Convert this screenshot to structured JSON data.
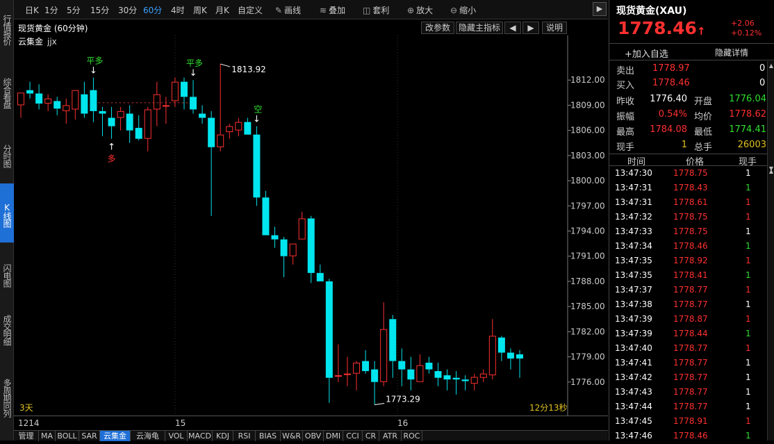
{
  "left_tabs": [
    "行情报价",
    "综合看盘",
    "分时图",
    "K线图",
    "闪电图",
    "成交明细",
    "多周期同列"
  ],
  "active_left_tab": "K线图",
  "toolbar": {
    "periods": [
      "日K",
      "1分",
      "5分",
      "15分",
      "30分",
      "60分",
      "4时",
      "周K",
      "月K",
      "自定义"
    ],
    "selected_period": "60分",
    "tools": [
      {
        "icon": "pencil-icon",
        "glyph": "✎",
        "label": "画线"
      },
      {
        "icon": "stack-icon",
        "glyph": "≋",
        "label": "叠加"
      },
      {
        "icon": "arbitrage-icon",
        "glyph": "◫",
        "label": "套利"
      },
      {
        "icon": "zoom-in-icon",
        "glyph": "⊕",
        "label": "放大"
      },
      {
        "icon": "zoom-out-icon",
        "glyph": "⊖",
        "label": "缩小"
      }
    ],
    "next_glyph": "▶"
  },
  "chart_header": {
    "title": "现货黄金 (60分钟)",
    "buttons": [
      "改参数",
      "隐藏主指标",
      "◀",
      "▶",
      "说明"
    ]
  },
  "indicator_label": "云集金",
  "indicator_param": "jjx",
  "bottom_left_label": "3天",
  "bottom_right_label": "12分13秒",
  "x_labels": [
    "1214",
    "15",
    "16"
  ],
  "indicator_tabs": [
    "管理",
    "MA",
    "BOLL",
    "SAR",
    "云集金",
    "云海龟",
    "VOL",
    "MACD",
    "KDJ",
    "RSI",
    "BIAS",
    "W&R",
    "OBV",
    "DMI",
    "CCI",
    "CR",
    "ATR",
    "ROC"
  ],
  "selected_indicator_tab": "云集金",
  "chart_data": {
    "type": "candlestick",
    "yticks": [
      "1812.00",
      "1809.00",
      "1806.00",
      "1803.00",
      "1800.00",
      "1797.00",
      "1794.00",
      "1791.00",
      "1788.00",
      "1785.00",
      "1782.00",
      "1779.00",
      "1776.00"
    ],
    "ylim": [
      1772.5,
      1815.5
    ],
    "high_label": "1813.92",
    "low_label": "1773.29",
    "reference_line": 1809.3,
    "signals": [
      {
        "text": "平多",
        "arrow": "↓",
        "bar": 8,
        "pos": "above",
        "color": "#30e030"
      },
      {
        "text": "多",
        "arrow": "↑",
        "bar": 10,
        "pos": "below",
        "color": "#ff3030"
      },
      {
        "text": "平多",
        "arrow": "↓",
        "bar": 19,
        "pos": "above",
        "color": "#30e030"
      },
      {
        "text": "空",
        "arrow": "↓",
        "bar": 26,
        "pos": "above",
        "color": "#30e030"
      }
    ],
    "candles": [
      {
        "o": 1809.0,
        "h": 1810.5,
        "l": 1807.5,
        "c": 1810.5
      },
      {
        "o": 1810.8,
        "h": 1811.8,
        "l": 1809.8,
        "c": 1810.4
      },
      {
        "o": 1810.4,
        "h": 1811.5,
        "l": 1808.5,
        "c": 1809.2
      },
      {
        "o": 1809.2,
        "h": 1810.3,
        "l": 1808.3,
        "c": 1809.8
      },
      {
        "o": 1809.5,
        "h": 1810.0,
        "l": 1807.8,
        "c": 1808.6
      },
      {
        "o": 1808.3,
        "h": 1809.8,
        "l": 1806.8,
        "c": 1809.0
      },
      {
        "o": 1808.5,
        "h": 1810.8,
        "l": 1807.3,
        "c": 1810.8
      },
      {
        "o": 1810.3,
        "h": 1811.8,
        "l": 1807.5,
        "c": 1808.0
      },
      {
        "o": 1810.8,
        "h": 1812.3,
        "l": 1807.0,
        "c": 1808.3
      },
      {
        "o": 1808.3,
        "h": 1808.8,
        "l": 1805.3,
        "c": 1808.0
      },
      {
        "o": 1807.5,
        "h": 1808.8,
        "l": 1805.0,
        "c": 1806.5
      },
      {
        "o": 1807.5,
        "h": 1808.8,
        "l": 1806.0,
        "c": 1808.3
      },
      {
        "o": 1808.0,
        "h": 1809.0,
        "l": 1804.5,
        "c": 1806.0
      },
      {
        "o": 1806.3,
        "h": 1807.8,
        "l": 1804.8,
        "c": 1805.0
      },
      {
        "o": 1805.0,
        "h": 1808.8,
        "l": 1803.5,
        "c": 1808.5
      },
      {
        "o": 1808.5,
        "h": 1811.8,
        "l": 1806.5,
        "c": 1810.3
      },
      {
        "o": 1809.0,
        "h": 1810.0,
        "l": 1806.8,
        "c": 1809.0
      },
      {
        "o": 1809.5,
        "h": 1812.3,
        "l": 1808.8,
        "c": 1811.8
      },
      {
        "o": 1811.8,
        "h": 1812.3,
        "l": 1808.5,
        "c": 1810.0
      },
      {
        "o": 1810.0,
        "h": 1812.0,
        "l": 1808.0,
        "c": 1808.5
      },
      {
        "o": 1808.0,
        "h": 1809.0,
        "l": 1806.8,
        "c": 1807.5
      },
      {
        "o": 1807.5,
        "h": 1808.3,
        "l": 1795.8,
        "c": 1804.0
      },
      {
        "o": 1804.0,
        "h": 1813.92,
        "l": 1803.5,
        "c": 1805.5
      },
      {
        "o": 1805.8,
        "h": 1806.8,
        "l": 1805.0,
        "c": 1806.5
      },
      {
        "o": 1806.0,
        "h": 1807.5,
        "l": 1805.3,
        "c": 1807.0
      },
      {
        "o": 1807.0,
        "h": 1807.5,
        "l": 1805.5,
        "c": 1805.5
      },
      {
        "o": 1805.5,
        "h": 1806.5,
        "l": 1797.0,
        "c": 1798.0
      },
      {
        "o": 1798.0,
        "h": 1798.8,
        "l": 1793.5,
        "c": 1793.5
      },
      {
        "o": 1793.5,
        "h": 1794.5,
        "l": 1792.0,
        "c": 1793.0
      },
      {
        "o": 1793.0,
        "h": 1793.3,
        "l": 1788.5,
        "c": 1791.0
      },
      {
        "o": 1791.0,
        "h": 1792.5,
        "l": 1790.0,
        "c": 1792.5
      },
      {
        "o": 1793.0,
        "h": 1796.3,
        "l": 1793.0,
        "c": 1795.5
      },
      {
        "o": 1795.5,
        "h": 1795.8,
        "l": 1787.8,
        "c": 1789.0
      },
      {
        "o": 1789.0,
        "h": 1790.0,
        "l": 1788.0,
        "c": 1788.0
      },
      {
        "o": 1788.0,
        "h": 1788.3,
        "l": 1773.5,
        "c": 1776.5
      },
      {
        "o": 1776.8,
        "h": 1780.5,
        "l": 1776.0,
        "c": 1776.8
      },
      {
        "o": 1777.0,
        "h": 1779.0,
        "l": 1775.5,
        "c": 1777.0
      },
      {
        "o": 1777.0,
        "h": 1778.5,
        "l": 1775.0,
        "c": 1778.3
      },
      {
        "o": 1778.5,
        "h": 1779.8,
        "l": 1777.0,
        "c": 1777.3
      },
      {
        "o": 1777.5,
        "h": 1778.5,
        "l": 1773.29,
        "c": 1776.0
      },
      {
        "o": 1776.0,
        "h": 1785.5,
        "l": 1775.5,
        "c": 1782.3
      },
      {
        "o": 1783.5,
        "h": 1784.0,
        "l": 1776.5,
        "c": 1778.5
      },
      {
        "o": 1778.5,
        "h": 1780.0,
        "l": 1775.5,
        "c": 1777.5
      },
      {
        "o": 1777.5,
        "h": 1779.0,
        "l": 1775.0,
        "c": 1776.3
      },
      {
        "o": 1776.0,
        "h": 1779.3,
        "l": 1776.0,
        "c": 1778.0
      },
      {
        "o": 1778.3,
        "h": 1779.0,
        "l": 1777.0,
        "c": 1777.5
      },
      {
        "o": 1777.3,
        "h": 1778.3,
        "l": 1775.5,
        "c": 1776.5
      },
      {
        "o": 1776.8,
        "h": 1777.5,
        "l": 1775.0,
        "c": 1776.3
      },
      {
        "o": 1776.5,
        "h": 1777.3,
        "l": 1774.5,
        "c": 1776.3
      },
      {
        "o": 1776.3,
        "h": 1776.8,
        "l": 1775.0,
        "c": 1776.1
      },
      {
        "o": 1775.8,
        "h": 1777.0,
        "l": 1775.0,
        "c": 1776.6
      },
      {
        "o": 1776.5,
        "h": 1777.5,
        "l": 1776.0,
        "c": 1777.0
      },
      {
        "o": 1776.8,
        "h": 1783.5,
        "l": 1776.3,
        "c": 1781.5
      },
      {
        "o": 1781.3,
        "h": 1781.5,
        "l": 1778.5,
        "c": 1779.5
      },
      {
        "o": 1779.5,
        "h": 1780.0,
        "l": 1777.5,
        "c": 1778.8
      },
      {
        "o": 1779.3,
        "h": 1779.8,
        "l": 1776.5,
        "c": 1778.8
      }
    ]
  },
  "quote": {
    "name": "现货黄金(XAU)",
    "price": "1778.46",
    "arrow": "↑",
    "change": "+2.06",
    "change_pct": "+0.12%",
    "add_watch": "+加入自选",
    "hide_detail": "隐藏详情",
    "bid_label": "卖出",
    "bid_price": "1778.97",
    "bid_vol": "0",
    "ask_label": "买入",
    "ask_price": "1778.46",
    "ask_vol": "0",
    "stats": [
      {
        "l1": "昨收",
        "v1": "1776.40",
        "c1": "wht",
        "l2": "开盘",
        "v2": "1776.04",
        "c2": "grn"
      },
      {
        "l1": "振幅",
        "v1": "0.54%",
        "c1": "red",
        "l2": "均价",
        "v2": "1778.62",
        "c2": "red"
      },
      {
        "l1": "最高",
        "v1": "1784.08",
        "c1": "red",
        "l2": "最低",
        "v2": "1774.41",
        "c2": "grn"
      },
      {
        "l1": "现手",
        "v1": "1",
        "c1": "yel",
        "l2": "总手",
        "v2": "26003",
        "c2": "yel"
      }
    ],
    "ticks_header": [
      "时间",
      "价格",
      "现手"
    ],
    "ticks": [
      {
        "t": "13:47:30",
        "p": "1778.75",
        "v": "1",
        "c": "wht"
      },
      {
        "t": "13:47:31",
        "p": "1778.43",
        "v": "1",
        "c": "grn"
      },
      {
        "t": "13:47:31",
        "p": "1778.61",
        "v": "1",
        "c": "red"
      },
      {
        "t": "13:47:32",
        "p": "1778.75",
        "v": "1",
        "c": "red"
      },
      {
        "t": "13:47:33",
        "p": "1778.75",
        "v": "1",
        "c": "wht"
      },
      {
        "t": "13:47:34",
        "p": "1778.46",
        "v": "1",
        "c": "grn"
      },
      {
        "t": "13:47:35",
        "p": "1778.92",
        "v": "1",
        "c": "red"
      },
      {
        "t": "13:47:35",
        "p": "1778.41",
        "v": "1",
        "c": "grn"
      },
      {
        "t": "13:47:37",
        "p": "1778.77",
        "v": "1",
        "c": "red"
      },
      {
        "t": "13:47:38",
        "p": "1778.77",
        "v": "1",
        "c": "wht"
      },
      {
        "t": "13:47:39",
        "p": "1778.87",
        "v": "1",
        "c": "red"
      },
      {
        "t": "13:47:39",
        "p": "1778.44",
        "v": "1",
        "c": "grn"
      },
      {
        "t": "13:47:40",
        "p": "1778.77",
        "v": "1",
        "c": "red"
      },
      {
        "t": "13:47:41",
        "p": "1778.77",
        "v": "1",
        "c": "wht"
      },
      {
        "t": "13:47:42",
        "p": "1778.77",
        "v": "1",
        "c": "wht"
      },
      {
        "t": "13:47:43",
        "p": "1778.77",
        "v": "1",
        "c": "wht"
      },
      {
        "t": "13:47:44",
        "p": "1778.77",
        "v": "1",
        "c": "wht"
      },
      {
        "t": "13:47:45",
        "p": "1778.91",
        "v": "1",
        "c": "red"
      },
      {
        "t": "13:47:46",
        "p": "1778.46",
        "v": "1",
        "c": "grn"
      }
    ]
  },
  "colors": {
    "up": "#ff3030",
    "down": "#00e5ee",
    "accent": "#1e6fd6"
  }
}
